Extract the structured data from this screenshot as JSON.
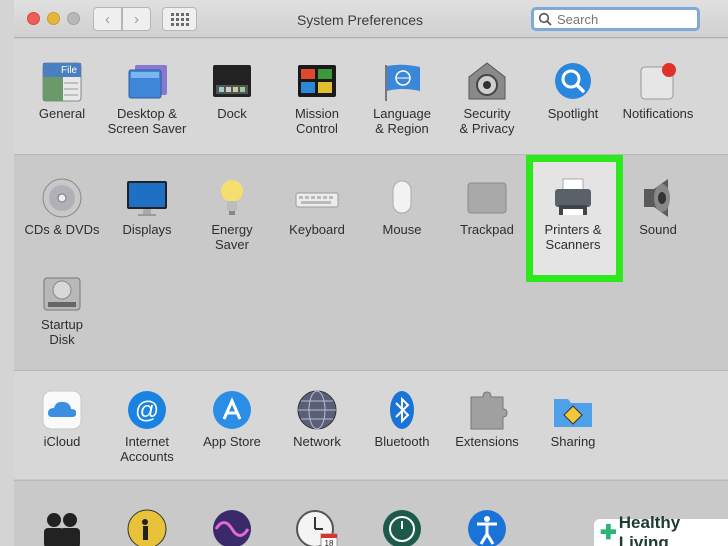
{
  "window": {
    "title": "System Preferences"
  },
  "search": {
    "placeholder": "Search"
  },
  "row1": [
    {
      "label": "General",
      "icon": "general-icon"
    },
    {
      "label": "Desktop &\nScreen Saver",
      "icon": "desktop-icon"
    },
    {
      "label": "Dock",
      "icon": "dock-icon"
    },
    {
      "label": "Mission\nControl",
      "icon": "mission-control-icon"
    },
    {
      "label": "Language\n& Region",
      "icon": "language-icon"
    },
    {
      "label": "Security\n& Privacy",
      "icon": "security-icon"
    },
    {
      "label": "Spotlight",
      "icon": "spotlight-icon"
    },
    {
      "label": "Notifications",
      "icon": "notifications-icon"
    }
  ],
  "row2": [
    {
      "label": "CDs & DVDs",
      "icon": "cd-icon"
    },
    {
      "label": "Displays",
      "icon": "display-icon"
    },
    {
      "label": "Energy\nSaver",
      "icon": "bulb-icon"
    },
    {
      "label": "Keyboard",
      "icon": "keyboard-icon"
    },
    {
      "label": "Mouse",
      "icon": "mouse-icon"
    },
    {
      "label": "Trackpad",
      "icon": "trackpad-icon"
    },
    {
      "label": "Printers &\nScanners",
      "icon": "printer-icon"
    },
    {
      "label": "Sound",
      "icon": "speaker-icon"
    }
  ],
  "row2b": [
    {
      "label": "Startup\nDisk",
      "icon": "disk-icon"
    }
  ],
  "row3": [
    {
      "label": "iCloud",
      "icon": "icloud-icon"
    },
    {
      "label": "Internet\nAccounts",
      "icon": "at-icon"
    },
    {
      "label": "App Store",
      "icon": "app-store-icon"
    },
    {
      "label": "Network",
      "icon": "network-icon"
    },
    {
      "label": "Bluetooth",
      "icon": "bluetooth-icon"
    },
    {
      "label": "Extensions",
      "icon": "puzzle-icon"
    },
    {
      "label": "Sharing",
      "icon": "sharing-icon"
    }
  ],
  "file_icon_text": "File",
  "calendar_date": "18",
  "watermark": "Healthy Living"
}
